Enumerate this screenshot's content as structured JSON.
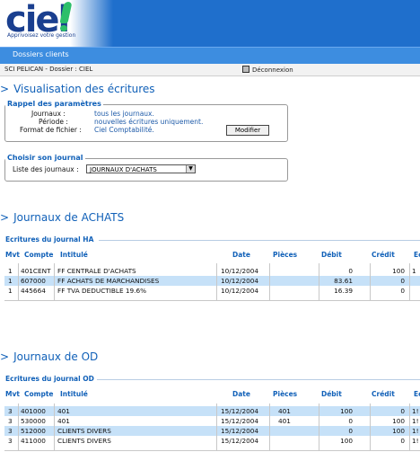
{
  "header": {
    "logo_text": "ciel",
    "logo_tagline": "Apprivoisez votre gestion",
    "colors": {
      "brand_blue": "#1f6fcc",
      "brand_green": "#2dbf6a"
    }
  },
  "nav": {
    "tab_label": "Dossiers clients"
  },
  "breadcrumb": {
    "text": "SCI PELICAN  -  Dossier : CIEL",
    "logout_label": "Déconnexion",
    "logout_icon": "logout-icon"
  },
  "page_title": "Visualisation des écritures",
  "params": {
    "title": "Rappel des paramètres",
    "rows": [
      {
        "label": "Journaux :",
        "value": "tous les journaux."
      },
      {
        "label": "Période :",
        "value": "nouvelles écritures uniquement."
      },
      {
        "label": "Format de fichier :",
        "value": "Ciel Comptabilité."
      }
    ],
    "modify_button": "Modifier"
  },
  "journal_choice": {
    "title": "Choisir son journal",
    "label": "Liste des journaux :",
    "selected": "JOURNAUX D'ACHATS"
  },
  "achats": {
    "title": "Journaux de ACHATS",
    "subtitle": "Ecritures du journal HA",
    "headers": [
      "Mvt",
      "Compte",
      "Intitulé",
      "Date",
      "Pièces",
      "Débit",
      "Crédit",
      "Ec"
    ],
    "rows": [
      {
        "mvt": "1",
        "compte": "401CENT",
        "intitule": "FF CENTRALE D'ACHATS",
        "date": "10/12/2004",
        "pieces": "",
        "debit": "0",
        "credit": "100",
        "ec": "1"
      },
      {
        "mvt": "1",
        "compte": "607000",
        "intitule": "FF ACHATS DE MARCHANDISES",
        "date": "10/12/2004",
        "pieces": "",
        "debit": "83.61",
        "credit": "0",
        "ec": ""
      },
      {
        "mvt": "1",
        "compte": "445664",
        "intitule": "FF TVA DEDUCTIBLE 19.6%",
        "date": "10/12/2004",
        "pieces": "",
        "debit": "16.39",
        "credit": "0",
        "ec": ""
      }
    ]
  },
  "od": {
    "title": "Journaux de OD",
    "subtitle": "Ecritures du journal OD",
    "headers": [
      "Mvt",
      "Compte",
      "Intitulé",
      "Date",
      "Pièces",
      "Débit",
      "Crédit",
      "Ec"
    ],
    "rows": [
      {
        "mvt": "3",
        "compte": "401000",
        "intitule": "401",
        "date": "15/12/2004",
        "pieces": "401",
        "debit": "100",
        "credit": "0",
        "ec": "1!"
      },
      {
        "mvt": "3",
        "compte": "530000",
        "intitule": "401",
        "date": "15/12/2004",
        "pieces": "401",
        "debit": "0",
        "credit": "100",
        "ec": "1!"
      },
      {
        "mvt": "3",
        "compte": "512000",
        "intitule": "CLIENTS DIVERS",
        "date": "15/12/2004",
        "pieces": "",
        "debit": "0",
        "credit": "100",
        "ec": "1!"
      },
      {
        "mvt": "3",
        "compte": "411000",
        "intitule": "CLIENTS DIVERS",
        "date": "15/12/2004",
        "pieces": "",
        "debit": "100",
        "credit": "0",
        "ec": "1!"
      }
    ]
  }
}
